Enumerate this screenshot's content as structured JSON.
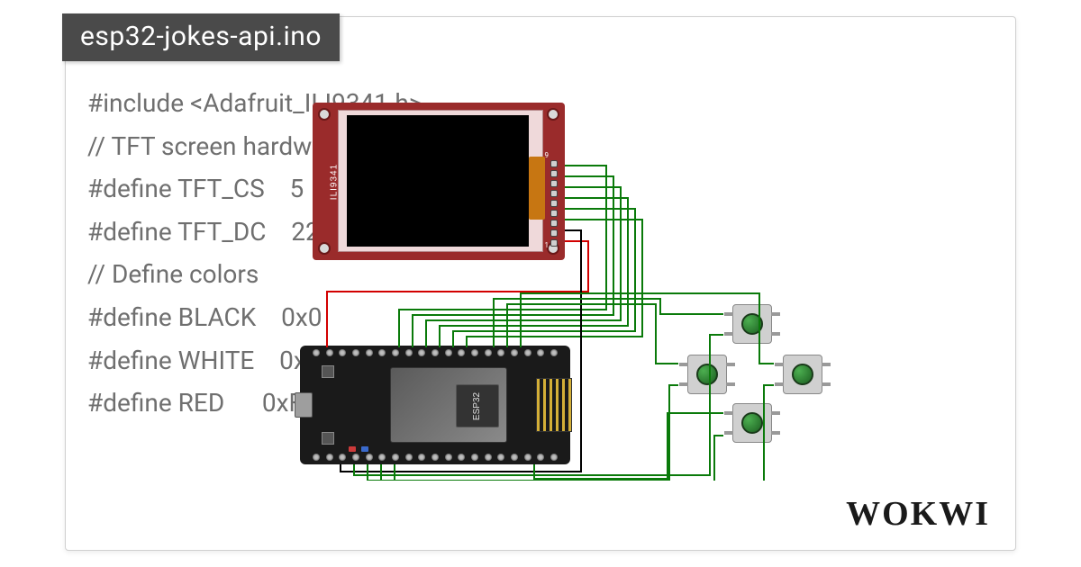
{
  "title": "esp32-jokes-api.ino",
  "code_lines": [
    "#include <Adafruit_ILI9341.h>",
    "",
    "// TFT screen hardw",
    "#define TFT_CS    5",
    "#define TFT_DC    22",
    "",
    "// Define colors",
    "#define BLACK    0x0",
    "#define WHITE    0xFFFF",
    "#define RED      0xF800"
  ],
  "components": {
    "display": {
      "model": "ILI9341",
      "pin_top": "9",
      "pin_bottom": "1"
    },
    "mcu": {
      "model": "ESP32"
    },
    "buttons": [
      "up",
      "left",
      "right",
      "down"
    ]
  },
  "brand": "WOKWI",
  "wire_colors": {
    "signal": "#0a7a0a",
    "power": "#d20000",
    "ground": "#000000"
  }
}
